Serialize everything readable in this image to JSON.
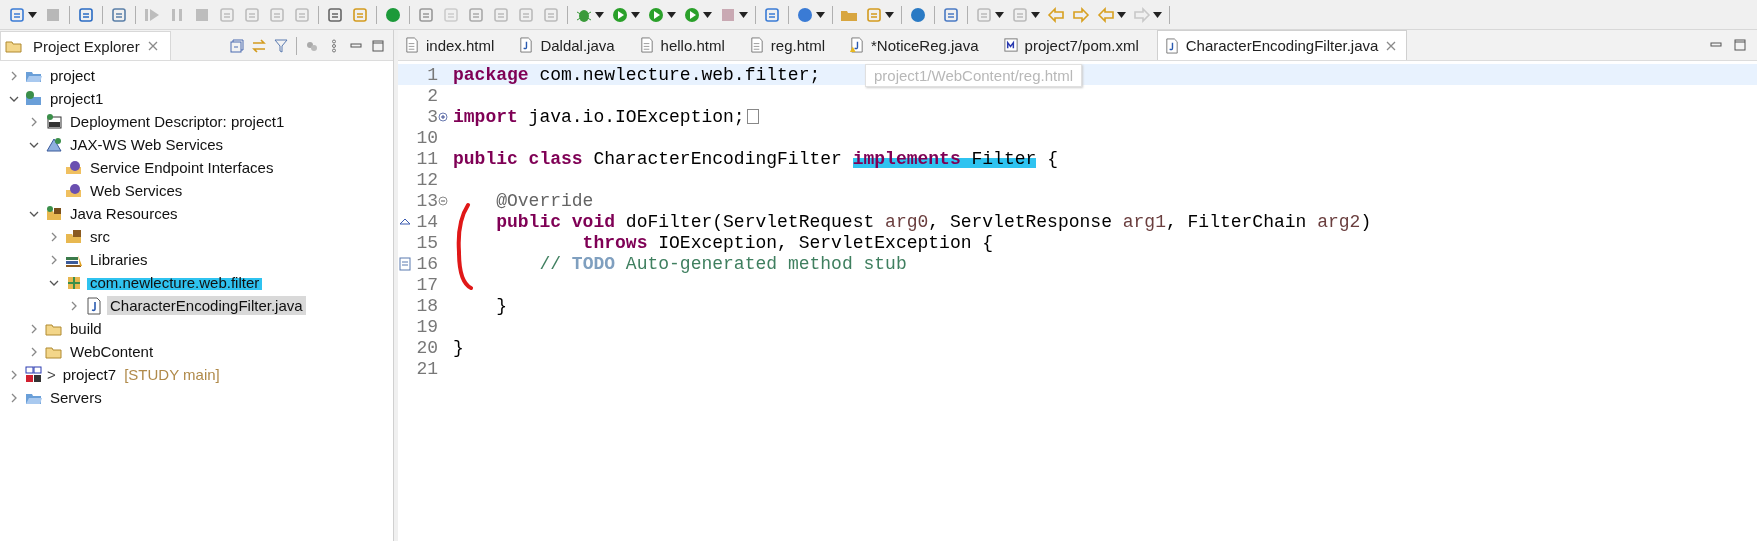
{
  "explorer": {
    "title": "Project Explorer",
    "tree": [
      {
        "label": "project",
        "kind": "project",
        "expanded": false,
        "selected": false
      },
      {
        "label": "project1",
        "kind": "web-project",
        "expanded": true,
        "selected": false,
        "children": [
          {
            "label": "Deployment Descriptor: project1",
            "kind": "deployment",
            "expanded": false,
            "selected": false
          },
          {
            "label": "JAX-WS Web Services",
            "kind": "jaxws",
            "expanded": true,
            "selected": false,
            "children": [
              {
                "label": "Service Endpoint Interfaces",
                "kind": "service",
                "selected": false
              },
              {
                "label": "Web Services",
                "kind": "service",
                "selected": false
              }
            ]
          },
          {
            "label": "Java Resources",
            "kind": "java-resources",
            "expanded": true,
            "selected": false,
            "children": [
              {
                "label": "src",
                "kind": "src",
                "expanded": false,
                "selected": false
              },
              {
                "label": "Libraries",
                "kind": "libraries",
                "expanded": false,
                "selected": false
              },
              {
                "label": "com.newlecture.web.filter",
                "kind": "package",
                "expanded": true,
                "selected": false,
                "highlighted": true,
                "children": [
                  {
                    "label": "CharacterEncodingFilter.java",
                    "kind": "java",
                    "expanded": false,
                    "selected": true
                  }
                ]
              }
            ]
          },
          {
            "label": "build",
            "kind": "folder",
            "expanded": false,
            "selected": false
          },
          {
            "label": "WebContent",
            "kind": "folder",
            "expanded": false,
            "selected": false
          }
        ]
      },
      {
        "label": "project7",
        "kind": "maven",
        "expanded": false,
        "selected": false,
        "prefix": ">",
        "tag": "[STUDY main]"
      },
      {
        "label": "Servers",
        "kind": "project",
        "expanded": false,
        "selected": false
      }
    ]
  },
  "editor_tabs": [
    {
      "label": "index.html",
      "kind": "html",
      "selected": false
    },
    {
      "label": "Daldal.java",
      "kind": "java",
      "selected": false
    },
    {
      "label": "hello.html",
      "kind": "html",
      "selected": false
    },
    {
      "label": "reg.html",
      "kind": "html",
      "selected": false
    },
    {
      "label": "*NoticeReg.java",
      "kind": "java-warn",
      "selected": false
    },
    {
      "label": "project7/pom.xml",
      "kind": "maven",
      "selected": false
    },
    {
      "label": "CharacterEncodingFilter.java",
      "kind": "java",
      "selected": true
    }
  ],
  "editor": {
    "tooltip": "project1/WebContent/reg.html",
    "lines": [
      {
        "number": "1",
        "current": true,
        "tokens": [
          {
            "kind": "kw",
            "text": "package"
          },
          {
            "kind": "plain",
            "text": " com.newlecture.web.filter;"
          }
        ]
      },
      {
        "number": "2",
        "current": false
      },
      {
        "number": "3",
        "current": false,
        "collapsed": true,
        "tokens": [
          {
            "kind": "kw",
            "text": "import"
          },
          {
            "kind": "plain",
            "text": " java.io.IOException;"
          }
        ]
      },
      {
        "number": "10",
        "current": false
      },
      {
        "number": "11",
        "current": false,
        "tokens": [
          {
            "kind": "kw",
            "text": "public class"
          },
          {
            "kind": "plain",
            "text": " CharacterEncodingFilter "
          },
          {
            "kind": "kw",
            "text": "implements",
            "highlighted": true
          },
          {
            "kind": "plain",
            "text": " Filter",
            "highlighted": true
          },
          {
            "kind": "plain",
            "text": " {"
          }
        ]
      },
      {
        "number": "12",
        "current": false
      },
      {
        "number": "13",
        "current": false,
        "collapsed": false,
        "tokens": [
          {
            "kind": "ann",
            "text": "    @Override"
          }
        ]
      },
      {
        "number": "14",
        "current": false,
        "kind": "override",
        "tokens": [
          {
            "kind": "kw",
            "text": "    public void"
          },
          {
            "kind": "plain",
            "text": " doFilter(ServletRequest "
          },
          {
            "kind": "param",
            "text": "arg0"
          },
          {
            "kind": "plain",
            "text": ", ServletResponse "
          },
          {
            "kind": "param",
            "text": "arg1"
          },
          {
            "kind": "plain",
            "text": ", FilterChain "
          },
          {
            "kind": "param",
            "text": "arg2"
          },
          {
            "kind": "plain",
            "text": ")"
          }
        ]
      },
      {
        "number": "15",
        "current": false,
        "tokens": [
          {
            "kind": "kw",
            "text": "            throws"
          },
          {
            "kind": "plain",
            "text": " IOException, ServletException {"
          }
        ]
      },
      {
        "number": "16",
        "current": false,
        "kind": "task",
        "tokens": [
          {
            "kind": "comment",
            "text": "        // "
          },
          {
            "kind": "todo",
            "text": "TODO"
          },
          {
            "kind": "comment",
            "text": " Auto-generated method stub"
          }
        ]
      },
      {
        "number": "17",
        "current": false
      },
      {
        "number": "18",
        "current": false,
        "tokens": [
          {
            "kind": "plain",
            "text": "    }"
          }
        ]
      },
      {
        "number": "19",
        "current": false
      },
      {
        "number": "20",
        "current": false,
        "tokens": [
          {
            "kind": "plain",
            "text": "}"
          }
        ]
      },
      {
        "number": "21",
        "current": false
      }
    ]
  }
}
